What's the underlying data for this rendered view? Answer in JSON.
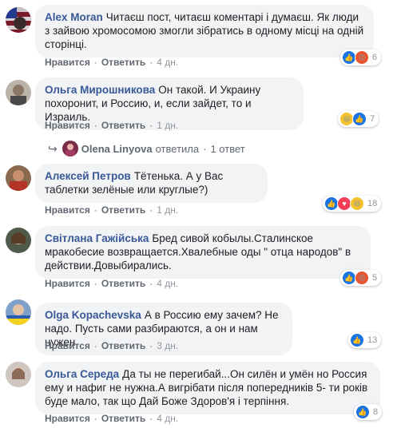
{
  "actions": {
    "like": "Нравится",
    "reply": "Ответить"
  },
  "comments": [
    {
      "author": "Alex Moran",
      "text": "Читаєш пост, читаєш коментарі і думаєш. Як люди з зайвою хромосомою змогли зібратись в одному місці на одній сторінці.",
      "time": "4 дн.",
      "reactions": [
        "like",
        "angry"
      ],
      "count": "6"
    },
    {
      "author": "Ольга Мирошникова",
      "text": "Он такой. И Украину похоронит, и Россию, и, если зайдет, то и Израиль.",
      "time": "1 дн.",
      "reactions": [
        "haha",
        "like"
      ],
      "count": "7"
    },
    {
      "author": "Алексей Петров",
      "text": "Тётенька. А у Вас таблетки зелёные или круглые?)",
      "time": "1 дн.",
      "reactions": [
        "like",
        "love",
        "haha"
      ],
      "count": "18"
    },
    {
      "author": "Світлана Гажійська",
      "text": "Бред сивой кобылы.Сталинское мракобесие возвращается.Хвалебные оды \" отца народов\" в действии.Довыбирались.",
      "time": "4 дн.",
      "reactions": [
        "like",
        "angry"
      ],
      "count": "5"
    },
    {
      "author": "Olga Kopachevska",
      "text": "А в Россию ему зачем? Не надо. Пусть сами разбираются, а он и нам нужен.",
      "time": "3 дн.",
      "reactions": [
        "like"
      ],
      "count": "13"
    },
    {
      "author": "Ольга Середа",
      "text": "Да ты не перегибай...Он силён и умён но Россия ему и нафиг не нужна.А вигрібати після попередників 5- ти років буде мало, так що Дай Боже Здоров'я і терпіння.",
      "time": "4 дн.",
      "reactions": [
        "like"
      ],
      "count": "8"
    }
  ],
  "reply_thread": {
    "name": "Olena Linyova",
    "verb": "ответила",
    "count": "1 ответ"
  }
}
